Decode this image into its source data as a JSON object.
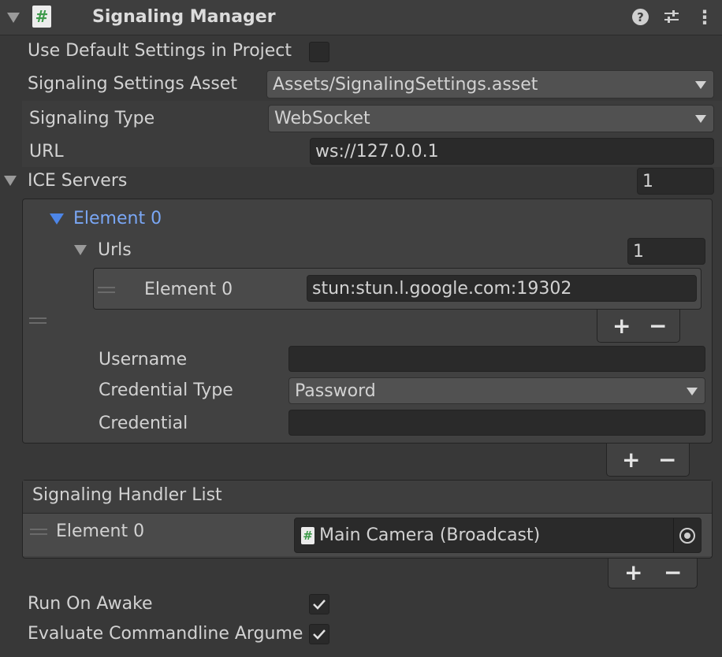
{
  "header": {
    "title": "Signaling Manager",
    "script_icon_glyph": "#",
    "help_icon_glyph": "?",
    "preset_icon": "sliders-icon",
    "more_icon_glyph": "⋮"
  },
  "use_default": {
    "label": "Use Default Settings in Project",
    "checked": false
  },
  "settings_asset": {
    "label": "Signaling Settings Asset",
    "value": "Assets/SignalingSettings.asset"
  },
  "signaling_type": {
    "label": "Signaling Type",
    "value": "WebSocket"
  },
  "url": {
    "label": "URL",
    "value": "ws://127.0.0.1"
  },
  "ice_servers": {
    "label": "ICE Servers",
    "count": "1",
    "element": {
      "label": "Element 0",
      "urls": {
        "label": "Urls",
        "count": "1",
        "items": [
          {
            "label": "Element 0",
            "value": "stun:stun.l.google.com:19302"
          }
        ],
        "plus": "+",
        "minus": "−"
      },
      "username": {
        "label": "Username",
        "value": ""
      },
      "credential_type": {
        "label": "Credential Type",
        "value": "Password"
      },
      "credential": {
        "label": "Credential",
        "value": ""
      }
    },
    "plus": "+",
    "minus": "−"
  },
  "handler_list": {
    "label": "Signaling Handler List",
    "items": [
      {
        "label": "Element 0",
        "value": "Main Camera (Broadcast)",
        "icon_glyph": "#"
      }
    ],
    "plus": "+",
    "minus": "−"
  },
  "run_on_awake": {
    "label": "Run On Awake",
    "checked": true
  },
  "evaluate_args": {
    "label": "Evaluate Commandline Argume",
    "checked": true
  },
  "colors": {
    "background": "#383838",
    "field": "#2a2a2a",
    "dropdown": "#515151",
    "element_accent": "#7aa7f5",
    "script_icon_green": "#3d9a4a"
  }
}
